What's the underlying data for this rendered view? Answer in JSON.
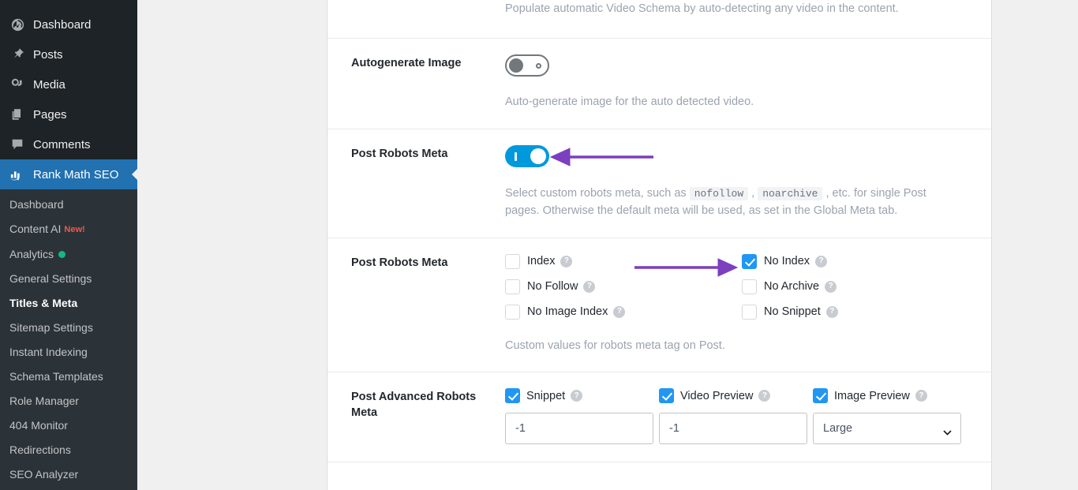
{
  "sidebar": {
    "main_items": [
      {
        "label": "Dashboard",
        "icon": "dashboard-icon"
      },
      {
        "label": "Posts",
        "icon": "pin-icon"
      },
      {
        "label": "Media",
        "icon": "media-icon"
      },
      {
        "label": "Pages",
        "icon": "pages-icon"
      },
      {
        "label": "Comments",
        "icon": "comment-icon"
      },
      {
        "label": "Rank Math SEO",
        "icon": "rank-math-icon"
      }
    ],
    "submenu": [
      {
        "label": "Dashboard",
        "badge": "",
        "dot": false,
        "active": false
      },
      {
        "label": "Content AI",
        "badge": "New!",
        "dot": false,
        "active": false
      },
      {
        "label": "Analytics",
        "badge": "",
        "dot": true,
        "active": false
      },
      {
        "label": "General Settings",
        "badge": "",
        "dot": false,
        "active": false
      },
      {
        "label": "Titles & Meta",
        "badge": "",
        "dot": false,
        "active": true
      },
      {
        "label": "Sitemap Settings",
        "badge": "",
        "dot": false,
        "active": false
      },
      {
        "label": "Instant Indexing",
        "badge": "",
        "dot": false,
        "active": false
      },
      {
        "label": "Schema Templates",
        "badge": "",
        "dot": false,
        "active": false
      },
      {
        "label": "Role Manager",
        "badge": "",
        "dot": false,
        "active": false
      },
      {
        "label": "404 Monitor",
        "badge": "",
        "dot": false,
        "active": false
      },
      {
        "label": "Redirections",
        "badge": "",
        "dot": false,
        "active": false
      },
      {
        "label": "SEO Analyzer",
        "badge": "",
        "dot": false,
        "active": false
      }
    ]
  },
  "settings": {
    "video_schema_desc": "Populate automatic Video Schema by auto-detecting any video in the content.",
    "autogenerate_image": {
      "label": "Autogenerate Image",
      "toggle_state": "off",
      "desc": "Auto-generate image for the auto detected video."
    },
    "post_robots_meta_toggle": {
      "label": "Post Robots Meta",
      "toggle_state": "on",
      "desc_part1": "Select custom robots meta, such as ",
      "desc_code1": "nofollow",
      "desc_sep": " , ",
      "desc_code2": "noarchive",
      "desc_part2": " , etc. for single Post pages. Otherwise the default meta will be used, as set in the Global Meta tab."
    },
    "post_robots_meta_checks": {
      "label": "Post Robots Meta",
      "options": [
        {
          "label": "Index",
          "checked": false,
          "help": "?"
        },
        {
          "label": "No Index",
          "checked": true,
          "help": "?"
        },
        {
          "label": "No Follow",
          "checked": false,
          "help": "?"
        },
        {
          "label": "No Archive",
          "checked": false,
          "help": "?"
        },
        {
          "label": "No Image Index",
          "checked": false,
          "help": "?"
        },
        {
          "label": "No Snippet",
          "checked": false,
          "help": "?"
        }
      ],
      "note": "Custom values for robots meta tag on Post."
    },
    "post_advanced_robots_meta": {
      "label": "Post Advanced Robots Meta",
      "columns": [
        {
          "label": "Snippet",
          "checked": true,
          "help": "?",
          "control": "input",
          "value": "-1",
          "placeholder": ""
        },
        {
          "label": "Video Preview",
          "checked": true,
          "help": "?",
          "control": "input",
          "value": "-1",
          "placeholder": ""
        },
        {
          "label": "Image Preview",
          "checked": true,
          "help": "?",
          "control": "select",
          "value": "Large",
          "options": [
            "Large"
          ]
        }
      ]
    }
  },
  "annotations": {
    "arrow_color": "#7b3fbf",
    "arrow_toggle_name": "arrow-pointing-to-post-robots-meta-toggle",
    "arrow_checkbox_name": "arrow-pointing-to-no-index-checkbox"
  },
  "colors": {
    "sidebar_bg": "#1d2327",
    "submenu_bg": "#2c3338",
    "current_menu": "#2271b1",
    "toggle_on": "#0099dd",
    "checkbox_checked": "#2196f3",
    "page_bg": "#f0f0f1",
    "panel_bg": "#ffffff",
    "accent_purple": "#7b3fbf"
  }
}
